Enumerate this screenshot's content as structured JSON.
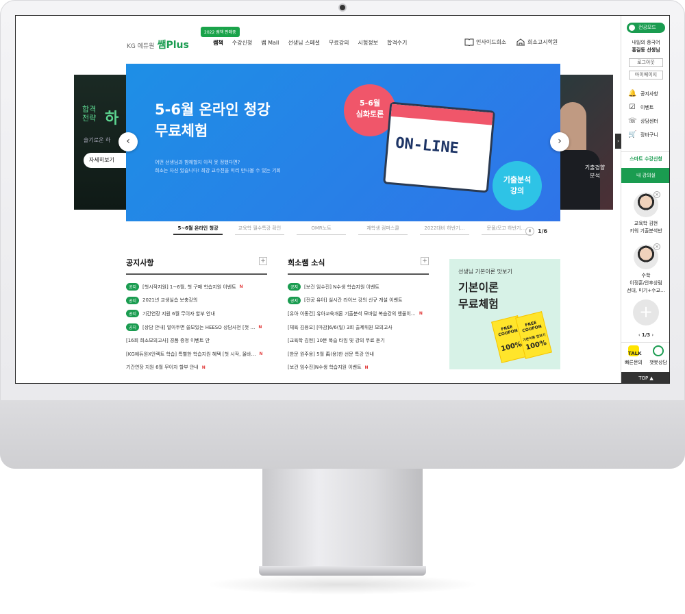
{
  "header": {
    "logo_prefix": "KG 에듀원",
    "logo_brand": "쌤Plus",
    "badge": "2022 쌤책 판매중",
    "nav": [
      "쌤책",
      "수강신청",
      "쌤 Mall",
      "선생님 스페셜",
      "무료강의",
      "시험정보",
      "합격수기"
    ],
    "util": [
      "인사이드희소",
      "희소고시학원"
    ]
  },
  "hero": {
    "left": {
      "t1": "합격\n전략",
      "t2": "하",
      "t3": "슬기로운 하",
      "btn": "자세히보기"
    },
    "title_line1": "5-6월 온라인 청강",
    "title_line2": "무료체험",
    "sub_line1": "어떤 선생님과 함께할지 아직 못 정했다면?",
    "sub_line2": "희소는 자신 있습니다! 최강 교수진을 미리 만나볼 수 있는 기회",
    "pink_badge": "5-6월\n심화토론",
    "online": "ON-LINE",
    "cyan_badge": "기출분석\n강의",
    "right_label": "기출경향\n분석",
    "prev": "‹",
    "next": "›"
  },
  "tabs": [
    "5~6월 온라인 청강",
    "교육학 필수특강 확인",
    "OMR노트",
    "재학생 컴퍼스쿨",
    "2022대비 하반기…",
    "문풀/모고 하반기…"
  ],
  "pager": {
    "pause": "Ⅱ",
    "page": "1/6"
  },
  "notice": {
    "title": "공지사항",
    "items": [
      {
        "tag": "공지",
        "text": "[첫시작지원] 1~6월, 첫 구매 학습지원 이벤트",
        "new": "N"
      },
      {
        "tag": "공지",
        "text": "2021년 교생실습 보충강의",
        "new": ""
      },
      {
        "tag": "공지",
        "text": "기간연장 지원 6월 무이자 할부 안내",
        "new": ""
      },
      {
        "tag": "공지",
        "text": "[상담 안내] 알아두면 쓸모있는 HEESO 상담사전 [첫 …",
        "new": "N"
      },
      {
        "tag": "",
        "text": "[16회 희소모의고사] 경품 증정 이벤트 안",
        "new": ""
      },
      {
        "tag": "",
        "text": "[KG에듀원X안렉트 학습] 특별한 학습지원 혜택 [첫 시작, 올바…",
        "new": "N"
      },
      {
        "tag": "",
        "text": "기간연장 지원 6월 무이자 할부 안내",
        "new": "N"
      }
    ]
  },
  "news": {
    "title": "희소쌤 소식",
    "items": [
      {
        "tag": "공지",
        "text": "[보건 임수진] N수생 학습지원 이벤트",
        "new": ""
      },
      {
        "tag": "공지",
        "text": "[전공 유아] 실시간 라이브 강의 신규 개설 이벤트",
        "new": ""
      },
      {
        "tag": "",
        "text": "[유아 이동건] 유아교육개론 기출분석 모바일 복습강의 앤울이…",
        "new": "N"
      },
      {
        "tag": "",
        "text": "[체육 김용오] [마감]6/6(일) 3회 출제위원 모의고사",
        "new": ""
      },
      {
        "tag": "",
        "text": "[교육학 김현] 10분 복습 타임 및 강의 무료 듣기",
        "new": ""
      },
      {
        "tag": "",
        "text": "[한문 원주용] 5월 禹(용)한 선문 특강 안내",
        "new": ""
      },
      {
        "tag": "",
        "text": "[보건 임수진]N수생 학습지원 이벤트",
        "new": "N"
      }
    ]
  },
  "promo": {
    "small": "선생님 기본이론 맛보기",
    "big_line1": "기본이론",
    "big_line2": "무료체험",
    "coupon1": "FREE\nCOUPON",
    "coupon2": "100%",
    "coupon_small": "기본이론 맛보기"
  },
  "right_panel": {
    "mode": "전공모드",
    "user_line1": "내일의 중국어",
    "user_line2": "홍길동 선생님",
    "logout": "로그아웃",
    "mypage": "마이페이지",
    "menu": [
      {
        "icon": "bell-icon",
        "glyph": "🔔",
        "label": "공지사항"
      },
      {
        "icon": "check-icon",
        "glyph": "☑",
        "label": "이벤트"
      },
      {
        "icon": "chat-icon",
        "glyph": "☏",
        "label": "상담센터"
      },
      {
        "icon": "cart-icon",
        "glyph": "🛒",
        "label": "장바구니"
      }
    ],
    "smart": "스마트 수강신청",
    "my": "내 강의실",
    "lec1_line1": "교육학 김현",
    "lec1_line2": "키워 기출분석반",
    "lec2_line1": "수학",
    "lec2_line2": "이정훈/안후상림",
    "lec2_line3": "선대, 미기+수교…",
    "add": "+",
    "page": "1/3",
    "faq": "빠른문의",
    "chatbot": "챗봇상담",
    "talk": "TALK",
    "top": "TOP ▲",
    "toggle": "›"
  },
  "colors": {
    "brand_green": "#1a9c50",
    "banner_blue": "#2a80e8",
    "pink": "#f0566a",
    "cyan": "#2ec3e6"
  }
}
